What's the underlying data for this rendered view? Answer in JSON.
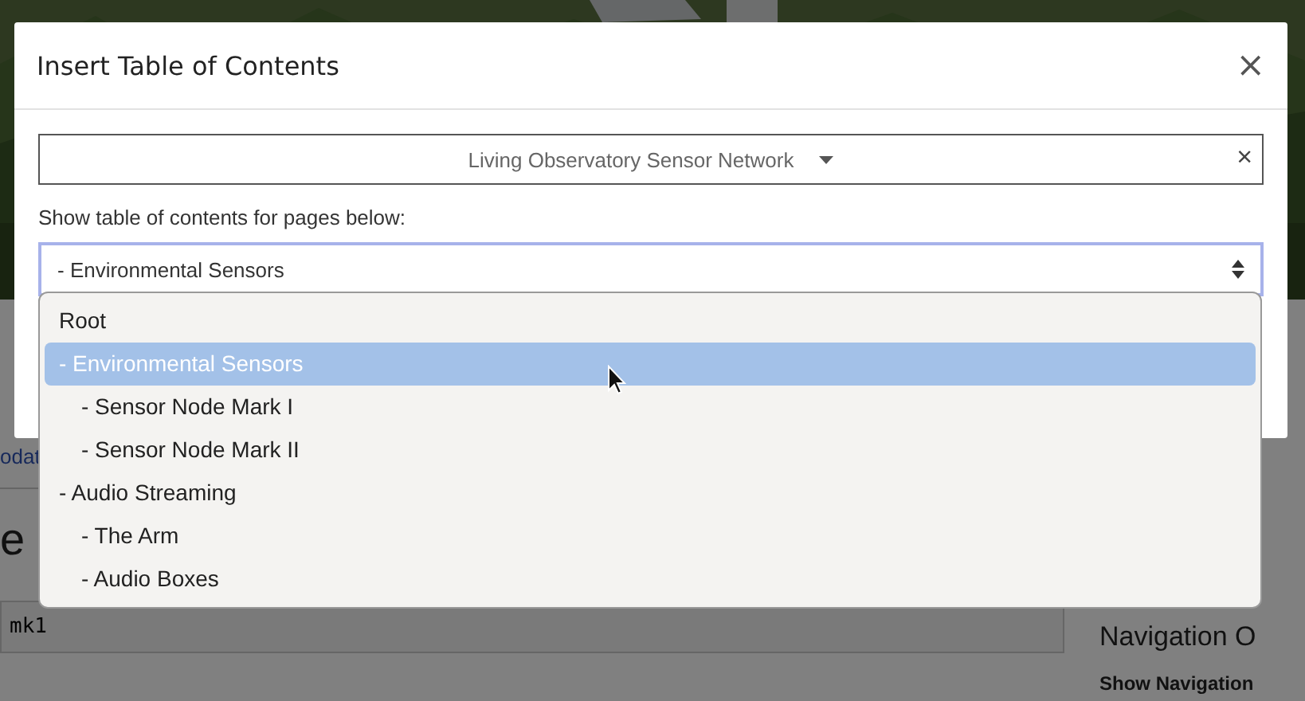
{
  "background_page": {
    "link_fragment": "odat",
    "heading_fragment": "e",
    "code_fragment": "mk1",
    "sidebar_heading": "Navigation O",
    "sidebar_label": "Show Navigation"
  },
  "dialog": {
    "title": "Insert Table of Contents",
    "close": "×",
    "site_select": {
      "value": "Living Observatory Sensor Network",
      "clear": "×"
    },
    "label": "Show table of contents for pages below:",
    "page_select": {
      "value": "- Environmental Sensors",
      "expanded": true
    },
    "options": [
      {
        "label": "Root",
        "selected": false
      },
      {
        "label": "- Environmental Sensors",
        "selected": true,
        "children": [
          {
            "label": "- Sensor Node Mark I",
            "selected": false
          },
          {
            "label": "- Sensor Node Mark II",
            "selected": false
          }
        ]
      },
      {
        "label": "- Audio Streaming",
        "selected": false,
        "children": [
          {
            "label": "- The Arm",
            "selected": false
          },
          {
            "label": "- Audio Boxes",
            "selected": false
          }
        ]
      }
    ]
  }
}
